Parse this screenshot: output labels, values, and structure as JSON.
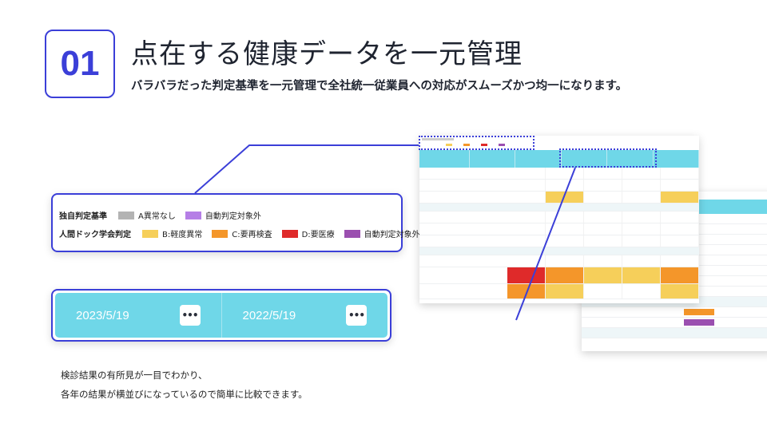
{
  "badge": "01",
  "title": "点在する健康データを一元管理",
  "subtitle": "バラバラだった判定基準を一元管理で全社統一従業員への対応がスムーズかつ均一になります。",
  "legend": {
    "row1_label": "独自判定基準",
    "row1_items": [
      {
        "label": "A異常なし",
        "color": "#b3b3b3"
      },
      {
        "label": "自動判定対象外",
        "color": "#b57ee6"
      }
    ],
    "row2_label": "人間ドック学会判定",
    "row2_items": [
      {
        "label": "B:軽度異常",
        "color": "#f6cf5a"
      },
      {
        "label": "C:要再検査",
        "color": "#f4962a"
      },
      {
        "label": "D:要医療",
        "color": "#df2a2a"
      },
      {
        "label": "自動判定対象外",
        "color": "#9b4fb0"
      }
    ]
  },
  "date_bar": {
    "dates": [
      "2023/5/19",
      "2022/5/19"
    ],
    "more_label": "•••"
  },
  "description": {
    "line1": "検診結果の有所見が一目でわかり、",
    "line2": "各年の結果が横並びになっているので簡単に比較できます。"
  },
  "colors": {
    "accent": "#3b3fd8",
    "header_cyan": "#6fd7e8"
  }
}
